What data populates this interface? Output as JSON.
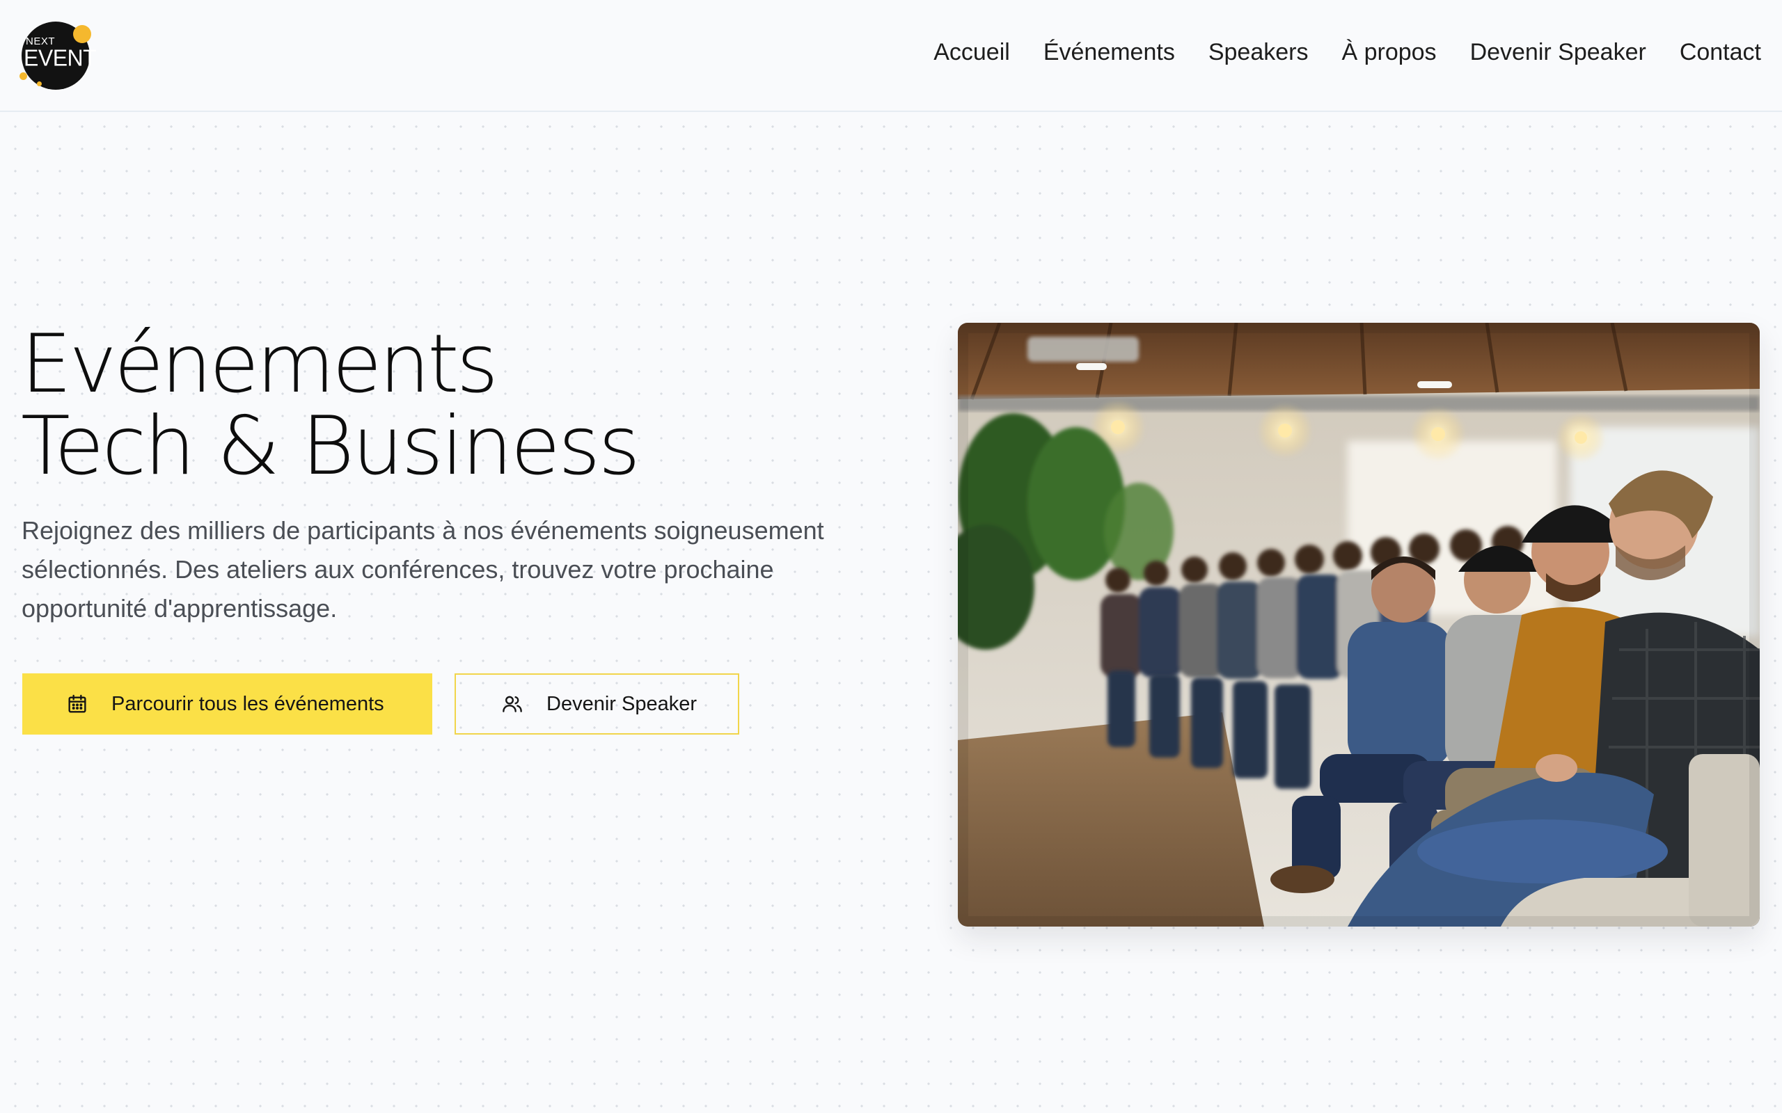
{
  "brand": {
    "logo_small_text": "NEXT",
    "logo_big_text": "EVENT",
    "accent_color": "#fbe047",
    "dot_color": "#f5b82e"
  },
  "nav": {
    "items": [
      {
        "label": "Accueil"
      },
      {
        "label": "Événements"
      },
      {
        "label": "Speakers"
      },
      {
        "label": "À propos"
      },
      {
        "label": "Devenir Speaker"
      },
      {
        "label": "Contact"
      }
    ]
  },
  "hero": {
    "title_line1": "Evénements",
    "title_line2": "Tech & Business",
    "description": "Rejoignez des milliers de participants à nos événements soigneusement sélectionnés. Des ateliers aux conférences, trouvez votre prochaine opportunité d'apprentissage.",
    "primary_button": {
      "label": "Parcourir tous les événements",
      "icon": "calendar-icon"
    },
    "secondary_button": {
      "label": "Devenir Speaker",
      "icon": "users-icon"
    },
    "image": {
      "subject": "conference-audience-photo"
    }
  }
}
